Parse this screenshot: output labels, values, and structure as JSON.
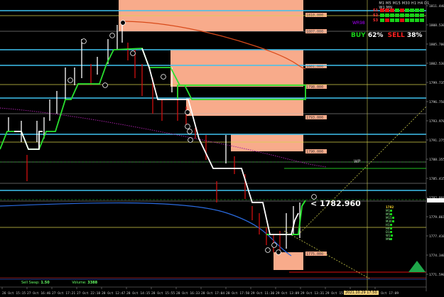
{
  "colors": {
    "background": "#000000",
    "zone": "#f8ab8b",
    "zone_border": "#ffffff",
    "cyan_line": "#3fc2ef",
    "yellow_line": "#d6d24b",
    "green_step": "#29e02f",
    "white_step": "#ffffff",
    "red_candle": "#d01010",
    "white_candle": "#ffffff",
    "red_ma": "#d84a1a",
    "blue_ma": "#2a6be0",
    "magenta_dots": "#a020a0",
    "buy_color": "#19d119",
    "sell_color": "#ff2020",
    "triangle_color": "#1fa84a"
  },
  "top_panel": {
    "wr_label": "WR98",
    "buy_label": "BUY",
    "buy_pct": "62%",
    "sell_label": "SELL",
    "sell_pct": "38%",
    "timeframes": [
      "M1",
      "M5",
      "M15",
      "M30",
      "H1",
      "H4",
      "D1",
      "W1",
      "MN"
    ],
    "rows": [
      {
        "name": "S1",
        "name_color": "#ff3030",
        "squares": [
          "#e01010",
          "#e01010",
          "#e01010",
          "#19d119",
          "#e01010",
          "#19d119",
          "#19d119",
          "#19d119",
          "#19d119"
        ]
      },
      {
        "name": "S2",
        "name_color": "#ff3030",
        "squares": [
          "#19d119",
          "#19d119",
          "#19d119",
          "#19d119",
          "#19d119",
          "#19d119",
          "#19d119",
          "#19d119",
          "#19d119"
        ]
      },
      {
        "name": "S3",
        "name_color": "#ff3030",
        "squares": [
          "#19d119",
          "#e01010",
          "#19d119",
          "#19d119",
          "#e01010",
          "#19d119",
          "#19d119",
          "#19d119",
          "#19d119"
        ]
      }
    ]
  },
  "price_tag": "< 1782.960",
  "wp_label": "WP",
  "price_axis": [
    {
      "label": "1811.440"
    },
    {
      "label": "1808.530"
    },
    {
      "label": "1805.700"
    },
    {
      "label": "1802.530"
    },
    {
      "label": "1799.735"
    },
    {
      "label": "1796.750"
    },
    {
      "label": "1793.970"
    },
    {
      "label": "1791.275"
    },
    {
      "label": "1788.355"
    },
    {
      "label": "1785.415"
    },
    {
      "label": "1782.960"
    },
    {
      "label": "1779.861"
    },
    {
      "label": "1777.410"
    },
    {
      "label": "1774.340"
    },
    {
      "label": "1771.590"
    }
  ],
  "zones": [
    {
      "label": "1810.000"
    },
    {
      "label": "1807.000"
    },
    {
      "label": "1801.000"
    },
    {
      "label": "1798.000"
    },
    {
      "label": "1793.000"
    },
    {
      "label": "1790.000"
    },
    {
      "label": "1775.000"
    }
  ],
  "time_axis": [
    "26 Oct 15:15",
    "27 Oct 16:46",
    "27 Oct 17:21",
    "27 Oct 22:18",
    "28 Oct 12:47",
    "28 Oct 14:15",
    "28 Oct 15:55",
    "28 Oct 16:33",
    "28 Oct 17:04",
    "28 Oct 17:50",
    "29 Oct 11:30",
    "29 Oct 13:09",
    "29 Oct 13:31",
    "29 Oct 15:43",
    "29 Oct 16:26",
    "29 Oct 17:09"
  ],
  "date_highlight": "2021.10.29 17:50",
  "legend": {
    "items": [
      "M1",
      "M5",
      "M15",
      "M30",
      "H1",
      "H4",
      "D1",
      "W1",
      "MN"
    ],
    "value": "1782"
  },
  "bottom": {
    "sell_swap_label": "Sell Swap:",
    "sell_swap_value": "1.50",
    "volume_label": "Volume:",
    "volume_value": "3388"
  }
}
